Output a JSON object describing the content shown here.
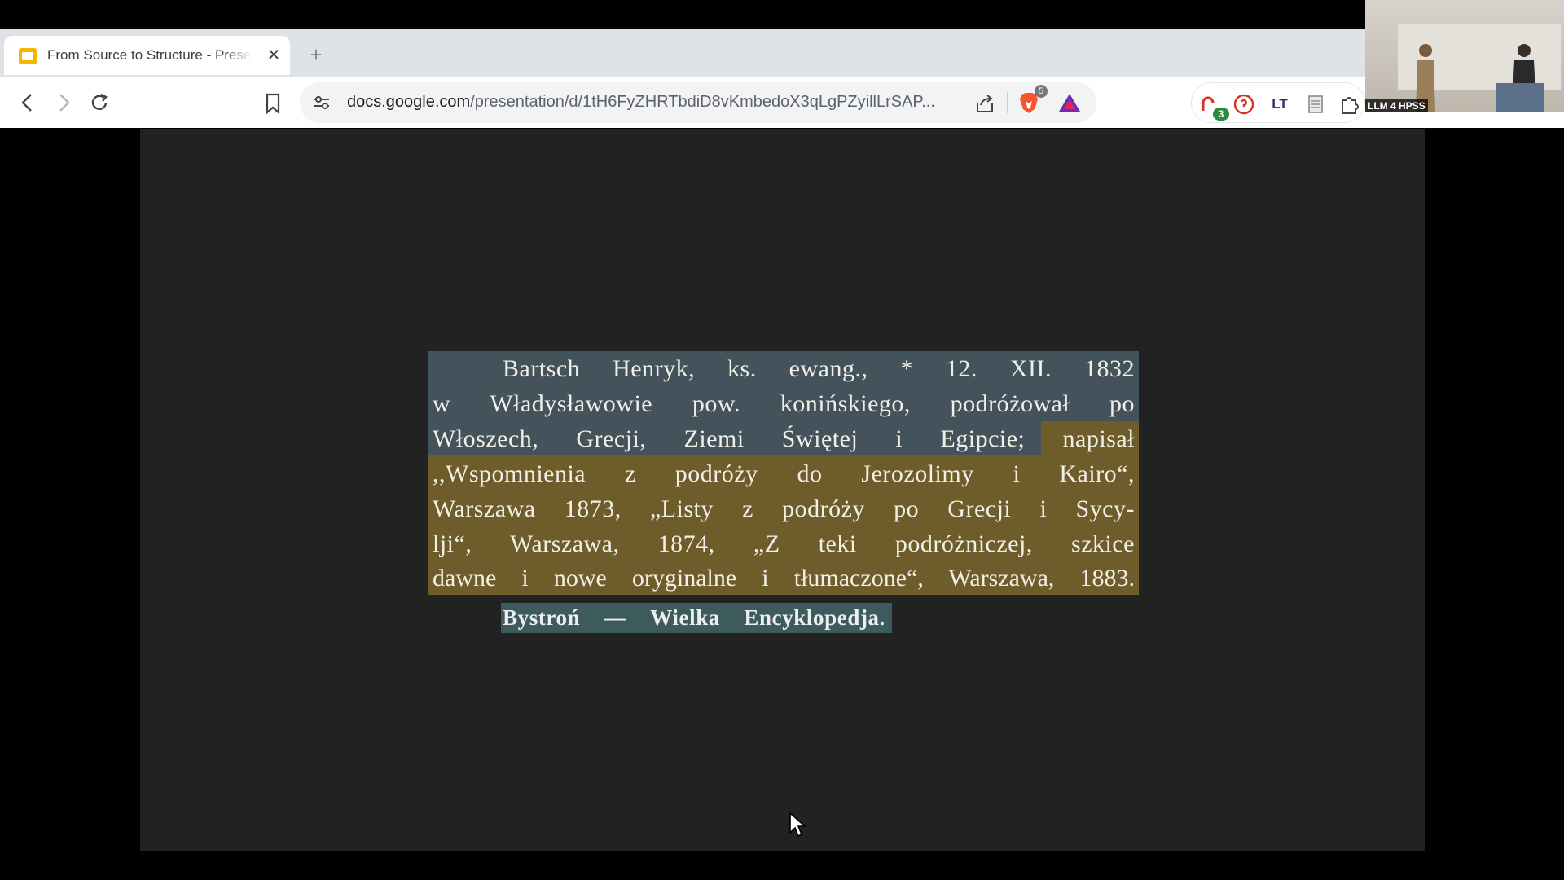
{
  "browser": {
    "tab": {
      "title": "From Source to Structure - Presentation",
      "close_glyph": "✕"
    },
    "new_tab_glyph": "+",
    "url": {
      "domain": "docs.google.com",
      "path": "/presentation/d/1tH6FyZHRTbdiD8vKmbedoX3qLgPZyillLrSAP..."
    },
    "brave_shields_count": "5",
    "extension_badge_count": "3",
    "lt_extension_label": "LT",
    "accent_colors": {
      "slides_yellow": "#f4b400",
      "brave_orange": "#fb542b"
    }
  },
  "webcam": {
    "label": "LLM 4 HPSS"
  },
  "slide": {
    "text_lines": [
      "Bartsch Henryk, ks. ewang., * 12. XII. 1832",
      "w Władysławowie pow. konińskiego, podróżował po",
      "Włoszech, Grecji, Ziemi Świętej i Egipcie; napisał",
      ",,Wspomnienia z podróży do Jerozolimy i Kairo“,",
      "Warszawa 1873, „Listy z podróży po Grecji i Sycy-",
      "lji“, Warszawa, 1874, „Z teki podróżniczej, szkice",
      "dawne i nowe oryginalne i tłumaczone“, Warszawa, 1883."
    ],
    "source_line": "Bystroń — Wielka Encyklopedja.",
    "highlight_colors": {
      "biography": "#44525c",
      "works": "#6e5c2a",
      "source": "#3d5a5c"
    }
  }
}
